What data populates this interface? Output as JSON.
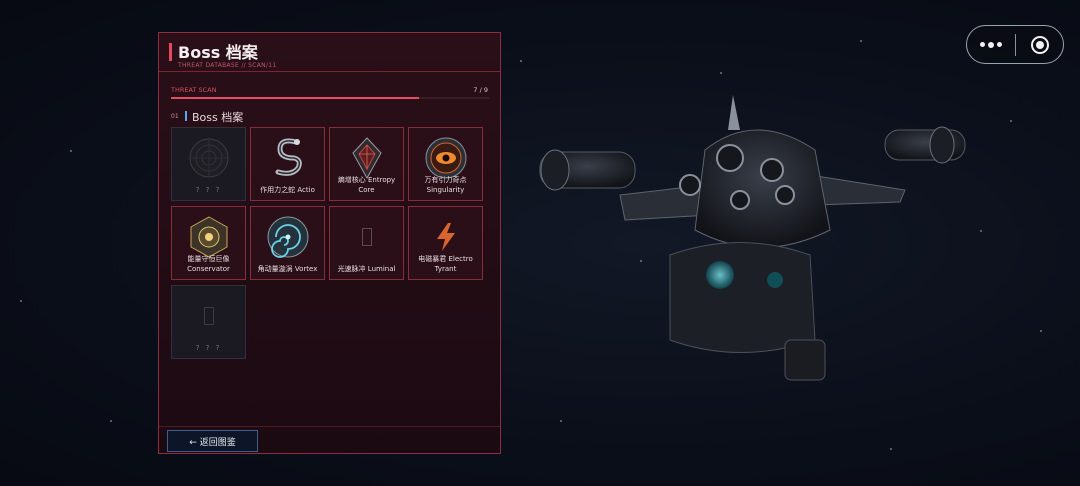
{
  "panel": {
    "title": "Boss 档案",
    "subtitle": "THREAT DATABASE // SCAN/11",
    "scan": {
      "label": "THREAT SCAN",
      "count": "7 / 9",
      "progress": 0.78
    },
    "section": {
      "number": "01",
      "title": "Boss 档案"
    },
    "cards": [
      {
        "name": "? ? ?",
        "locked": true,
        "icon": "locked-portal-icon"
      },
      {
        "name": "作用力之蛇 Actio",
        "locked": false,
        "icon": "serpent-icon"
      },
      {
        "name": "熵增核心 Entropy Core",
        "locked": false,
        "icon": "entropy-crystal-icon"
      },
      {
        "name": "万有引力奇点 Singularity",
        "locked": false,
        "icon": "singularity-eye-icon"
      },
      {
        "name": "能量守恒巨像 Conservator",
        "locked": false,
        "icon": "conservator-icon"
      },
      {
        "name": "角动量漩涡 Vortex",
        "locked": false,
        "icon": "vortex-icon"
      },
      {
        "name": "光速脉冲 Luminal",
        "locked": false,
        "icon": "luminal-placeholder-icon"
      },
      {
        "name": "电磁暴君 Electro Tyrant",
        "locked": false,
        "icon": "lightning-icon"
      },
      {
        "name": "? ? ?",
        "locked": true,
        "icon": "locked-placeholder-icon"
      }
    ],
    "back_button": "← 返回图鉴"
  },
  "colors": {
    "accent": "#e14a5e",
    "panel_bg": "#2a0f18",
    "card_border": "#8a2b3c",
    "section_bar": "#5aa7f2",
    "lightning": "#d8642e"
  }
}
